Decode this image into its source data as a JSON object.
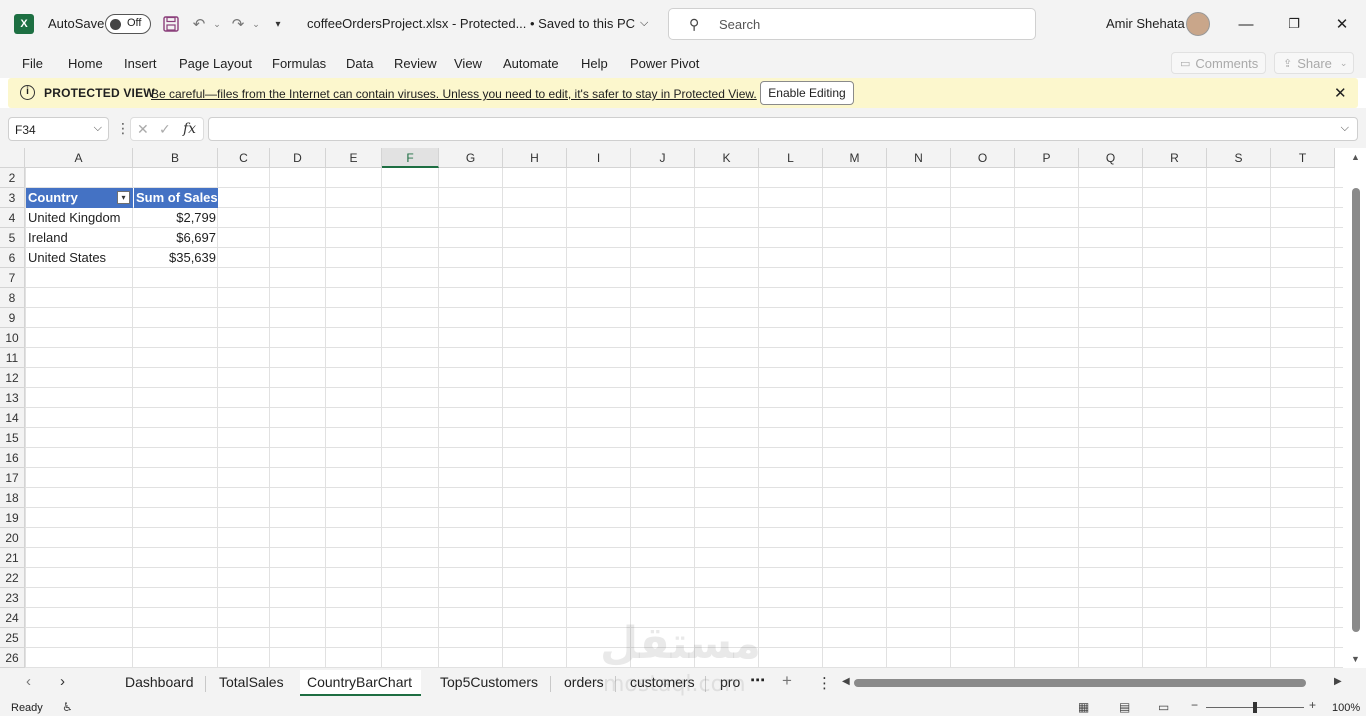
{
  "titlebar": {
    "app_logo": "X",
    "autosave_label": "AutoSave",
    "autosave_state": "Off",
    "filename": "coffeeOrdersProject.xlsx  -  Protected...   •  Saved to this PC",
    "search_placeholder": "Search",
    "username": "Amir Shehata"
  },
  "menu": {
    "items": [
      "File",
      "Home",
      "Insert",
      "Page Layout",
      "Formulas",
      "Data",
      "Review",
      "View",
      "Automate",
      "Help",
      "Power Pivot"
    ],
    "comments": "Comments",
    "share": "Share"
  },
  "protected_view": {
    "title": "PROTECTED VIEW",
    "message": "Be careful—files from the Internet can contain viruses. Unless you need to edit, it's safer to stay in Protected View.",
    "enable_button": "Enable Editing"
  },
  "formula_bar": {
    "name_box": "F34",
    "fx": "fx",
    "formula": ""
  },
  "grid": {
    "selected_column": "F",
    "columns": [
      "A",
      "B",
      "C",
      "D",
      "E",
      "F",
      "G",
      "H",
      "I",
      "J",
      "K",
      "L",
      "M",
      "N",
      "O",
      "P",
      "Q",
      "R",
      "S",
      "T"
    ],
    "rows": [
      "2",
      "3",
      "4",
      "5",
      "6",
      "7",
      "8",
      "9",
      "10",
      "11",
      "12",
      "13",
      "14",
      "15",
      "16",
      "17",
      "18",
      "19",
      "20",
      "21",
      "22",
      "23",
      "24",
      "25",
      "26"
    ]
  },
  "pivot": {
    "header_country": "Country",
    "header_sales": "Sum of Sales",
    "rows": [
      {
        "country": "United Kingdom",
        "sales": "$2,799"
      },
      {
        "country": "Ireland",
        "sales": "$6,697"
      },
      {
        "country": "United States",
        "sales": "$35,639"
      }
    ]
  },
  "sheets": {
    "tabs": [
      "Dashboard",
      "TotalSales",
      "CountryBarChart",
      "Top5Customers",
      "orders",
      "customers",
      "pro"
    ],
    "active": "CountryBarChart"
  },
  "status": {
    "ready": "Ready",
    "zoom": "100%"
  },
  "watermark": {
    "arabic": "مستقل",
    "latin": "mostaql.com"
  },
  "colors": {
    "pivot_header": "#4472c4",
    "excel_green": "#1e6e42",
    "protected_bar": "#fcf7cd"
  }
}
